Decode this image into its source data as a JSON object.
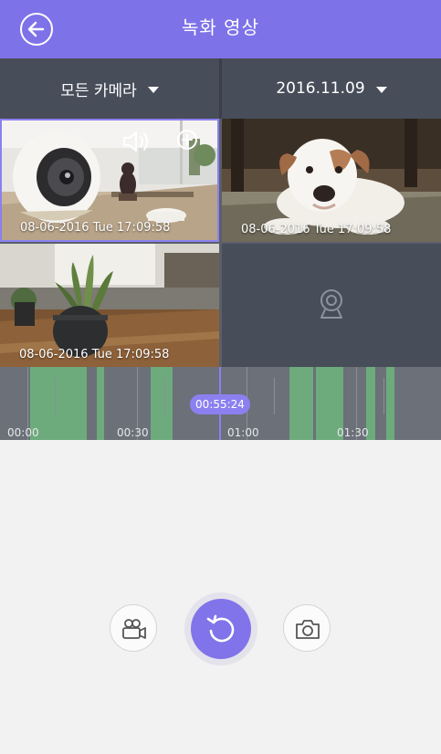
{
  "header": {
    "title": "녹화 영상",
    "back_icon": "arrow-left-icon"
  },
  "filters": {
    "camera_label": "모든 카메라",
    "date_label": "2016.11.09"
  },
  "tiles": [
    {
      "timestamp": "08-06-2016 Tue 17:09:58",
      "selected": true,
      "icons": [
        "speaker-icon",
        "zoom-in-icon"
      ]
    },
    {
      "timestamp": "08-06-2016 Tue 17:09:58"
    },
    {
      "timestamp": "08-06-2016 Tue 17:09:58"
    },
    {
      "empty": true,
      "icon": "camera-placeholder-icon"
    }
  ],
  "timeline": {
    "labels": [
      "00:00",
      "00:30",
      "01:00",
      "01:30"
    ],
    "current_time": "00:55:24"
  },
  "controls": {
    "record_icon": "video-camera-icon",
    "main_icon": "replay-icon",
    "capture_icon": "camera-icon"
  },
  "colors": {
    "accent": "#7e72e8",
    "filter_bar": "#474d59",
    "timeline": "#6b7079",
    "recorded_segment": "#6dab7c",
    "background": "#f2f2f3"
  }
}
